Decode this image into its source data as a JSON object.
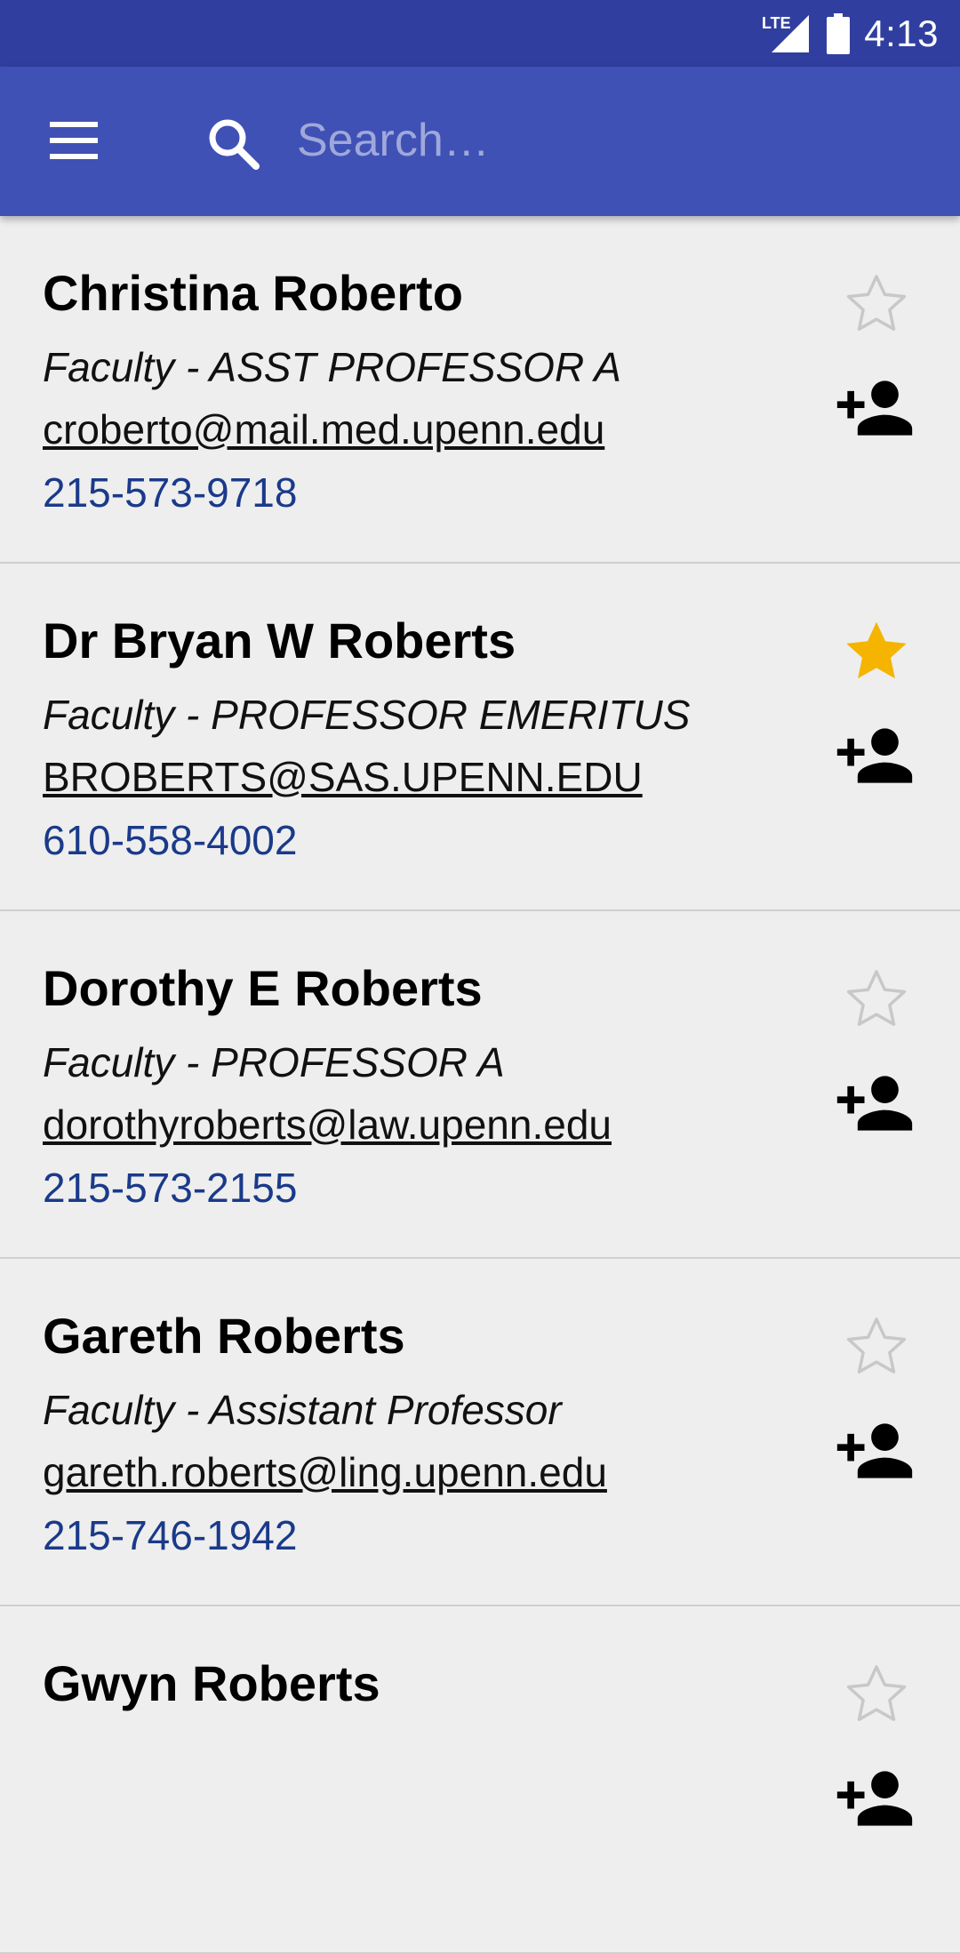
{
  "status_bar": {
    "network": "LTE",
    "time": "4:13"
  },
  "search": {
    "placeholder": "Search…",
    "value": ""
  },
  "people": [
    {
      "name": "Christina Roberto",
      "title": "Faculty - ASST PROFESSOR A",
      "email": "croberto@mail.med.upenn.edu",
      "phone": "215-573-9718",
      "favorite": false
    },
    {
      "name": "Dr Bryan W Roberts",
      "title": "Faculty - PROFESSOR EMERITUS",
      "email": "BROBERTS@SAS.UPENN.EDU",
      "phone": "610-558-4002",
      "favorite": true
    },
    {
      "name": "Dorothy E Roberts",
      "title": "Faculty - PROFESSOR A",
      "email": "dorothyroberts@law.upenn.edu",
      "phone": "215-573-2155",
      "favorite": false
    },
    {
      "name": "Gareth Roberts",
      "title": "Faculty - Assistant Professor",
      "email": "gareth.roberts@ling.upenn.edu",
      "phone": "215-746-1942",
      "favorite": false
    },
    {
      "name": "Gwyn Roberts",
      "title": "",
      "email": "",
      "phone": "",
      "favorite": false
    }
  ],
  "icons": {
    "menu": "menu-icon",
    "search": "search-icon",
    "star": "star-icon",
    "add_person": "person-add-icon",
    "signal": "signal-icon",
    "battery": "battery-icon"
  },
  "colors": {
    "status_bar": "#303f9f",
    "app_bar": "#3f51b5",
    "background": "#eeeeee",
    "star_filled": "#f4b400",
    "star_outline": "#c8c8c8",
    "phone_link": "#1a3a8a"
  }
}
